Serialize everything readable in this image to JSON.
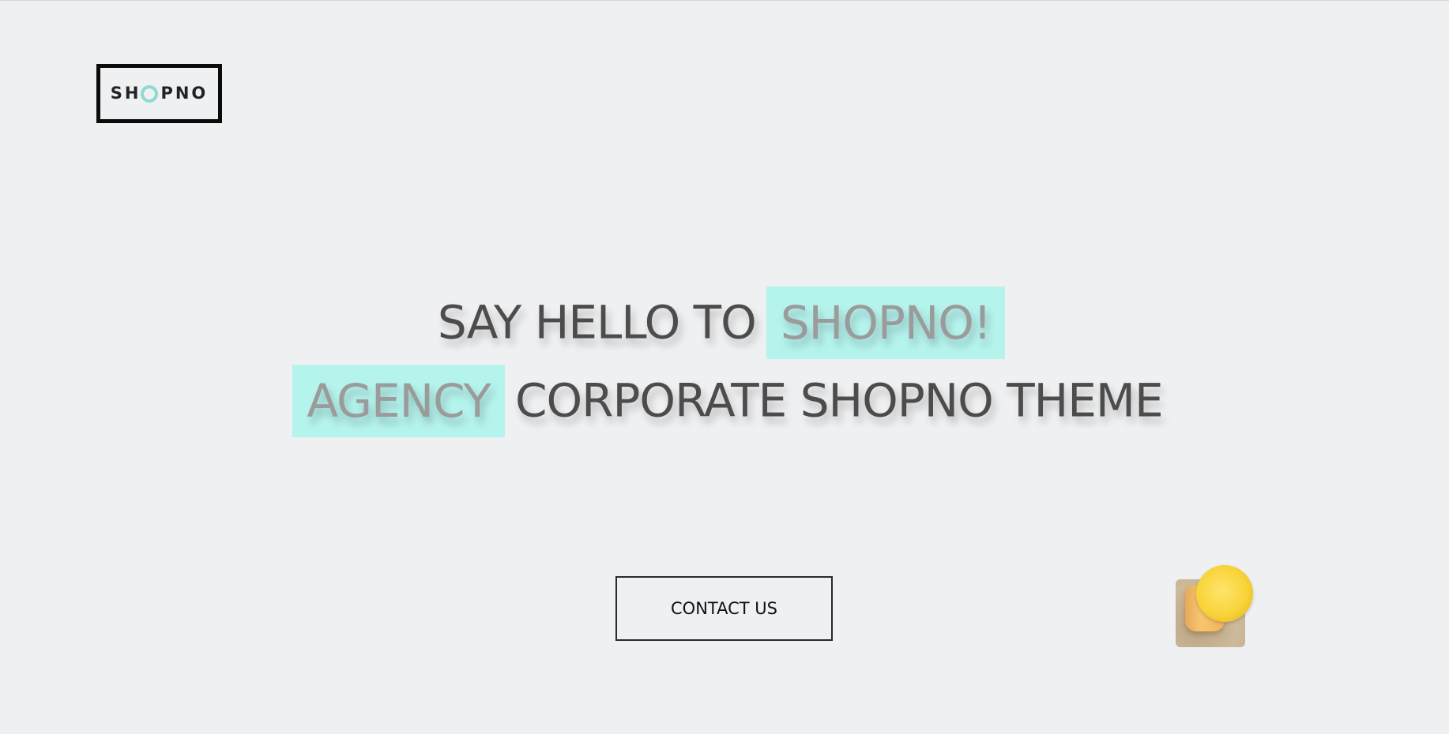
{
  "brand": {
    "logo_text_before": "SH",
    "logo_text_after": "PNO",
    "accent_color": "#8fd9d2",
    "highlight_color": "#b5f3ed"
  },
  "hero": {
    "line1_text": "SAY HELLO TO",
    "line1_highlight": "SHOPNO!",
    "line2_highlight": "AGENCY",
    "line2_text": "CORPORATE SHOPNO THEME"
  },
  "cta": {
    "contact_label": "CONTACT US"
  },
  "widget": {
    "icon": "orange-juice-glass-icon"
  }
}
